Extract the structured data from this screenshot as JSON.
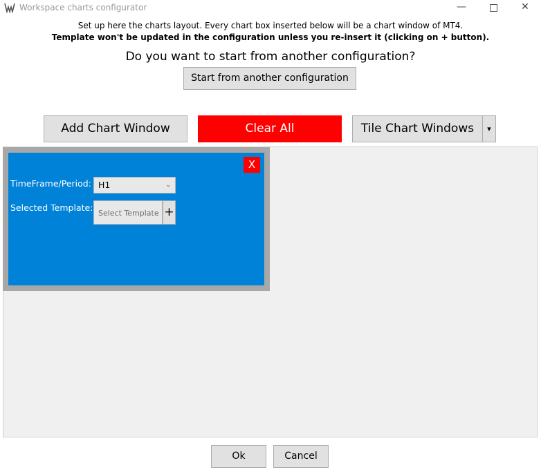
{
  "window": {
    "title": "Workspace charts configurator",
    "minimize_glyph": "—",
    "close_glyph": "✕"
  },
  "header": {
    "info_line1": "Set up here the charts layout. Every chart box inserted below will be a chart window of MT4.",
    "info_line2": "Template won't be updated in the configuration unless you re-insert it (clicking on + button).",
    "question": "Do you want to start from another configuration?",
    "start_button": "Start from another configuration"
  },
  "toolbar": {
    "add_label": "Add Chart Window",
    "clear_label": "Clear All",
    "tile_label": "Tile Chart Windows",
    "tile_dropdown_glyph": "▾"
  },
  "chart_box": {
    "close_label": "X",
    "timeframe_label": "TimeFrame/Period:",
    "timeframe_value": "H1",
    "template_label": "Selected Template:",
    "template_placeholder": "Select Template",
    "add_template_label": "+",
    "chevron_glyph": "⌄"
  },
  "footer": {
    "ok_label": "Ok",
    "cancel_label": "Cancel"
  },
  "colors": {
    "clear_button": "#ff0000",
    "chart_inner": "#0082d9",
    "chart_border": "#a8a8a8",
    "workspace": "#f0f0f0"
  },
  "icons": {
    "app": "mt-logo-icon",
    "minimize": "minimize-icon",
    "maximize": "maximize-icon",
    "close": "close-icon"
  }
}
